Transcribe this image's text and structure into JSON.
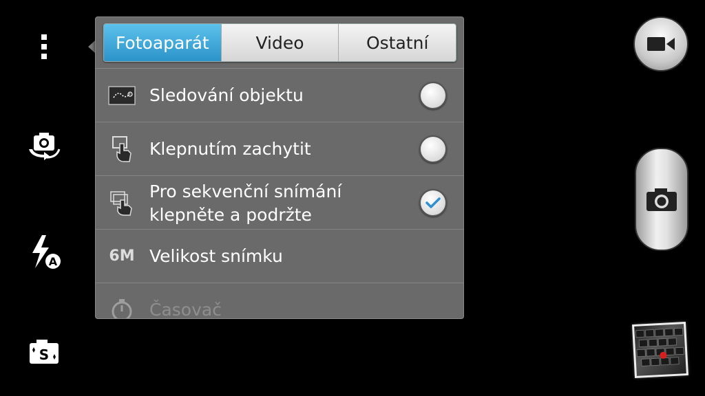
{
  "left_toolbar": {
    "menu_icon": "more-vertical-icon",
    "switch_camera_icon": "camera-switch-icon",
    "flash_icon": "flash-auto-icon",
    "shooting_mode_icon": "shooting-mode-s-icon",
    "flash_badge": "A",
    "mode_badge": "S"
  },
  "popup": {
    "tabs": [
      {
        "label": "Fotoaparát",
        "active": true
      },
      {
        "label": "Video",
        "active": false
      },
      {
        "label": "Ostatní",
        "active": false
      }
    ],
    "items": [
      {
        "icon": "object-tracking-icon",
        "label": "Sledování objektu",
        "checked": false
      },
      {
        "icon": "touch-capture-icon",
        "label": "Klepnutím zachytit",
        "checked": false
      },
      {
        "icon": "burst-shot-icon",
        "label_line1": "Pro sekvenční snímání",
        "label_line2": "klepněte a podržte",
        "checked": true
      },
      {
        "icon": "resolution-icon",
        "icon_text": "6M",
        "label": "Velikost snímku"
      },
      {
        "icon": "timer-icon",
        "label": "Časovač"
      }
    ]
  },
  "right_controls": {
    "video_icon": "video-camera-icon",
    "shutter_icon": "camera-icon",
    "thumbnail": "gallery-thumbnail"
  },
  "colors": {
    "accent": "#2c93c9",
    "popup_bg": "#6a6a6a",
    "check": "#2f8fd0"
  }
}
